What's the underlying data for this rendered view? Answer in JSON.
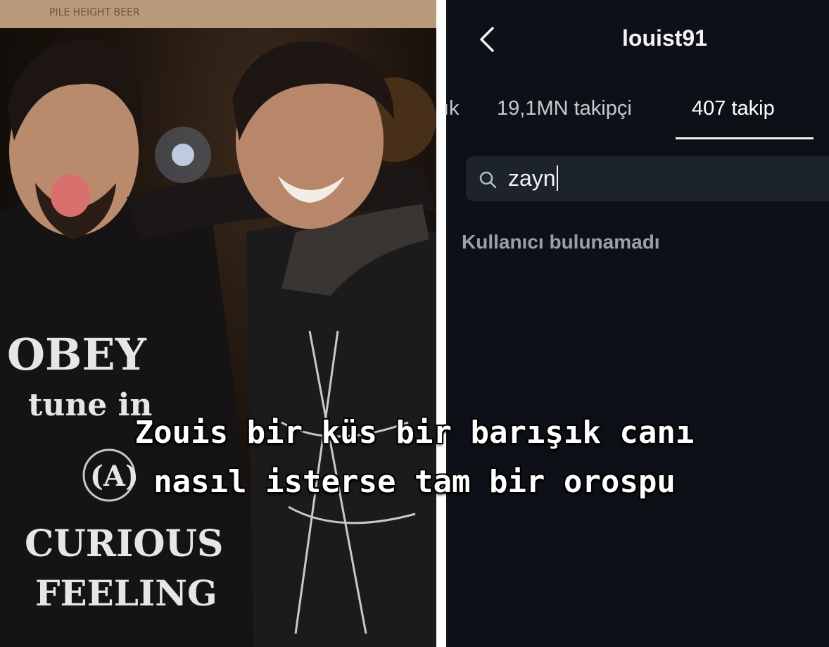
{
  "photo": {
    "shirt_text": [
      "OBEY",
      "tune in",
      "(A)",
      "CURIOUS",
      "FEELING"
    ],
    "sign_text": "PILE HEIGHT BEER"
  },
  "profile": {
    "username": "louist91",
    "tabs": [
      {
        "label": "ık"
      },
      {
        "label": "19,1MN takipçi"
      },
      {
        "label": "407 takip"
      }
    ],
    "search": {
      "value": "zayn"
    },
    "empty_message": "Kullanıcı bulunamadı"
  },
  "caption": {
    "line1": "Zouis bir küs bir barışık canı",
    "line2": "nasıl isterse tam bir orospu"
  },
  "colors": {
    "background": "#0d1117",
    "search_bg": "#1d232c",
    "muted_text": "#9aa0a8"
  }
}
